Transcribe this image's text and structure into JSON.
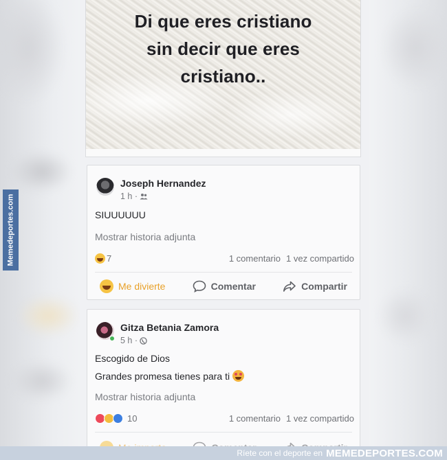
{
  "meme_image": {
    "line1": "Di que eres cristiano",
    "line2": "sin decir que eres",
    "line3": "cristiano.."
  },
  "posts": [
    {
      "author": "Joseph Hernandez",
      "time": "1 h ·",
      "privacy_icon": "friends-icon",
      "lines": [
        "SIUUUUUU"
      ],
      "attachment": "Mostrar historia adjunta",
      "reaction_count": "7",
      "comments": "1 comentario",
      "shares": "1 vez compartido",
      "actions": {
        "react": "Me divierte",
        "comment": "Comentar",
        "share": "Compartir"
      }
    },
    {
      "author": "Gitza Betania Zamora",
      "time": "5 h ·",
      "privacy_icon": "globe-icon",
      "lines": [
        "Escogido de Dios",
        "Grandes promesa tienes para ti"
      ],
      "attachment": "Mostrar historia adjunta",
      "reaction_count": "10",
      "comments": "1 comentario",
      "shares": "1 vez compartido",
      "actions": {
        "react": "Me importa",
        "comment": "Comentar",
        "share": "Compartir"
      }
    }
  ],
  "watermark": {
    "side": "Memedeportes.com",
    "tagline": "Ríete con el deporte en",
    "brand": "MEMEDEPORTES.COM"
  },
  "colors": {
    "accent_reaction": "#e8a12a",
    "watermark_blue": "#4b6fa1",
    "online": "#44b356"
  }
}
